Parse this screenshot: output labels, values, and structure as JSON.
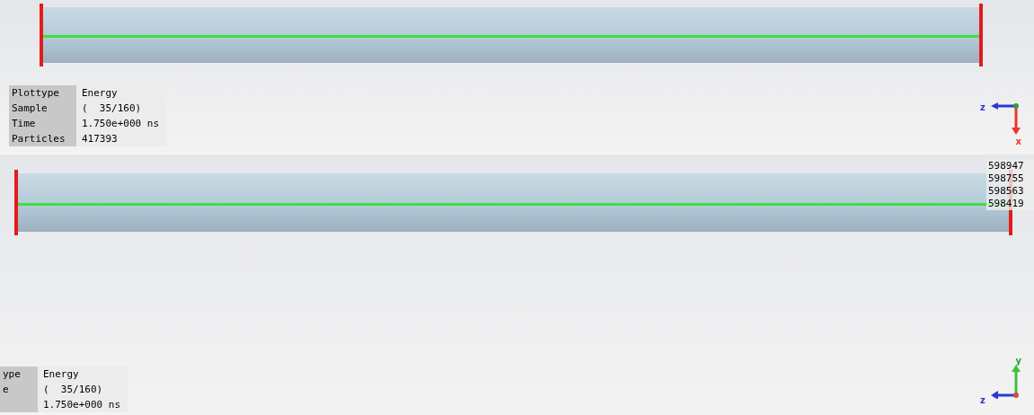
{
  "views": [
    {
      "info": [
        {
          "label": "Plottype",
          "value": "Energy"
        },
        {
          "label": "Sample",
          "value": "(  35/160)"
        },
        {
          "label": "Time",
          "value": "1.750e+000 ns"
        },
        {
          "label": "Particles",
          "value": "417393"
        }
      ],
      "axes": {
        "horizontal": "z",
        "vertical": "x"
      }
    },
    {
      "info": [
        {
          "label": "ype",
          "value": "Energy"
        },
        {
          "label": "e",
          "value": "(  35/160)"
        },
        {
          "value": "1.750e+000 ns"
        }
      ],
      "axes": {
        "horizontal": "z",
        "vertical": "y"
      },
      "legend_values": [
        "598947",
        "598755",
        "598563",
        "598419"
      ]
    }
  ]
}
